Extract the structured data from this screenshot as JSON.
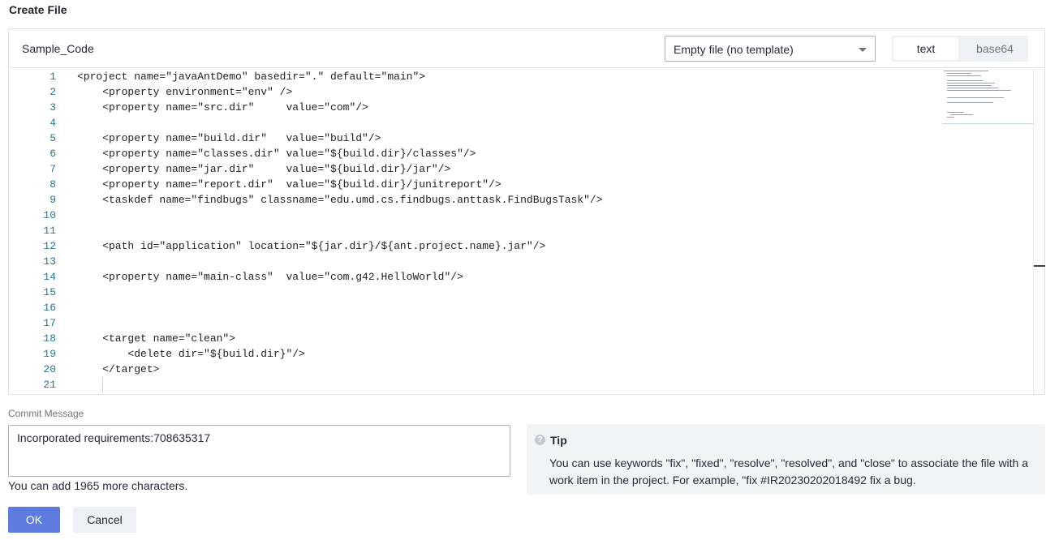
{
  "page": {
    "title": "Create File"
  },
  "editor": {
    "file_name": "Sample_Code",
    "template": {
      "selected": "Empty file (no template)"
    },
    "modes": {
      "text": "text",
      "base64": "base64",
      "active": "text"
    },
    "lines": [
      {
        "n": "1",
        "code": "<project name=\"javaAntDemo\" basedir=\".\" default=\"main\">"
      },
      {
        "n": "2",
        "code": "    <property environment=\"env\" />"
      },
      {
        "n": "3",
        "code": "    <property name=\"src.dir\"     value=\"com\"/>"
      },
      {
        "n": "4",
        "code": ""
      },
      {
        "n": "5",
        "code": "    <property name=\"build.dir\"   value=\"build\"/>"
      },
      {
        "n": "6",
        "code": "    <property name=\"classes.dir\" value=\"${build.dir}/classes\"/>"
      },
      {
        "n": "7",
        "code": "    <property name=\"jar.dir\"     value=\"${build.dir}/jar\"/>"
      },
      {
        "n": "8",
        "code": "    <property name=\"report.dir\"  value=\"${build.dir}/junitreport\"/>"
      },
      {
        "n": "9",
        "code": "    <taskdef name=\"findbugs\" classname=\"edu.umd.cs.findbugs.anttask.FindBugsTask\"/>"
      },
      {
        "n": "10",
        "code": ""
      },
      {
        "n": "11",
        "code": ""
      },
      {
        "n": "12",
        "code": "    <path id=\"application\" location=\"${jar.dir}/${ant.project.name}.jar\"/>"
      },
      {
        "n": "13",
        "code": ""
      },
      {
        "n": "14",
        "code": "    <property name=\"main-class\"  value=\"com.g42.HelloWorld\"/>"
      },
      {
        "n": "15",
        "code": ""
      },
      {
        "n": "16",
        "code": ""
      },
      {
        "n": "17",
        "code": ""
      },
      {
        "n": "18",
        "code": "    <target name=\"clean\">"
      },
      {
        "n": "19",
        "code": "        <delete dir=\"${build.dir}\"/>"
      },
      {
        "n": "20",
        "code": "    </target>"
      },
      {
        "n": "21",
        "code": ""
      }
    ]
  },
  "commit": {
    "label": "Commit Message",
    "value": "Incorporated requirements:708635317",
    "remaining_hint": "You can add 1965 more characters."
  },
  "tip": {
    "icon": "question-icon",
    "title": "Tip",
    "body": "You can use keywords \"fix\", \"fixed\", \"resolve\", \"resolved\", and \"close\" to associate the file with a work item in the project. For example, \"fix #IR20230202018492 fix a bug."
  },
  "actions": {
    "ok_label": "OK",
    "cancel_label": "Cancel"
  },
  "colors": {
    "primary": "#5e7ce0",
    "line_number": "#237893",
    "tip_bg": "#f2f3f5"
  }
}
